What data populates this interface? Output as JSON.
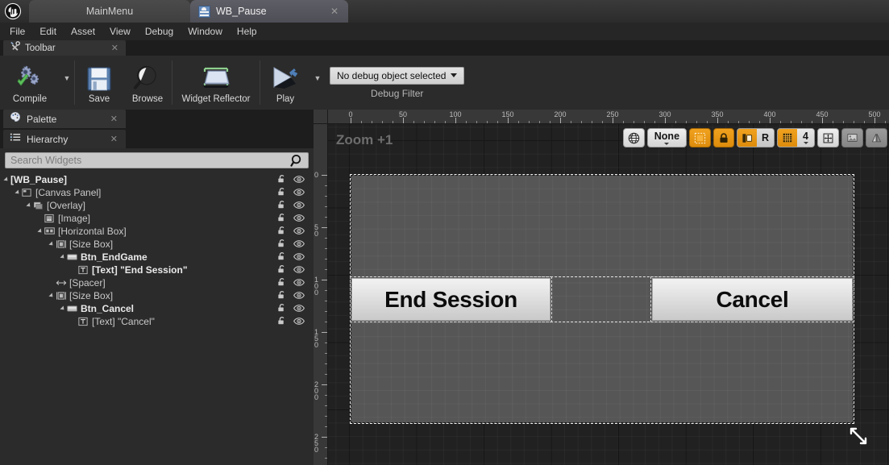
{
  "app": {
    "logo_icon": "unreal-engine-logo"
  },
  "tabs": [
    {
      "label": "MainMenu",
      "icon": "widget-blueprint-icon",
      "active": false,
      "close_label": "✕"
    },
    {
      "label": "WB_Pause",
      "icon": "widget-blueprint-icon",
      "active": true,
      "close_label": "✕"
    }
  ],
  "menubar": {
    "items": [
      "File",
      "Edit",
      "Asset",
      "View",
      "Debug",
      "Window",
      "Help"
    ]
  },
  "toolbar_panel": {
    "tab_label": "Toolbar",
    "tab_icon": "wrench-screwdriver-icon",
    "close_label": "✕",
    "buttons": [
      {
        "label": "Compile",
        "icon": "compile-gears-check-icon",
        "has_dropdown": true
      },
      {
        "label": "Save",
        "icon": "floppy-disk-icon",
        "has_dropdown": false
      },
      {
        "label": "Browse",
        "icon": "magnifier-icon",
        "has_dropdown": false
      },
      {
        "label": "Widget Reflector",
        "icon": "widget-reflector-icon",
        "has_dropdown": false
      },
      {
        "label": "Play",
        "icon": "play-triangle-icon",
        "has_dropdown": true
      }
    ],
    "debug_filter": {
      "value": "No debug object selected",
      "caption": "Debug Filter",
      "caret_icon": "chevron-down-icon"
    }
  },
  "left_panel": {
    "tabs": [
      {
        "label": "Palette",
        "icon": "palette-icon",
        "close_label": "✕",
        "active": false
      },
      {
        "label": "Hierarchy",
        "icon": "hierarchy-list-icon",
        "close_label": "✕",
        "active": true
      }
    ],
    "search": {
      "placeholder": "Search Widgets",
      "value": "",
      "icon": "search-icon"
    },
    "tree": [
      {
        "label": "[WB_Pause]",
        "indent": 0,
        "icon": "",
        "arrow": true,
        "bold": true,
        "lock": "unlocked-icon",
        "eye": "eye-icon"
      },
      {
        "label": "[Canvas Panel]",
        "indent": 1,
        "icon": "canvas",
        "arrow": true,
        "bold": false,
        "lock": "unlocked-icon",
        "eye": "eye-icon"
      },
      {
        "label": "[Overlay]",
        "indent": 2,
        "icon": "overlay",
        "arrow": true,
        "bold": false,
        "lock": "unlocked-icon",
        "eye": "eye-icon"
      },
      {
        "label": "[Image]",
        "indent": 3,
        "icon": "image",
        "arrow": false,
        "bold": false,
        "lock": "unlocked-icon",
        "eye": "eye-icon"
      },
      {
        "label": "[Horizontal Box]",
        "indent": 3,
        "icon": "hbox",
        "arrow": true,
        "bold": false,
        "lock": "unlocked-icon",
        "eye": "eye-icon"
      },
      {
        "label": "[Size Box]",
        "indent": 4,
        "icon": "sizebox",
        "arrow": true,
        "bold": false,
        "lock": "unlocked-icon",
        "eye": "eye-icon"
      },
      {
        "label": "Btn_EndGame",
        "indent": 5,
        "icon": "button",
        "arrow": true,
        "bold": true,
        "lock": "unlocked-icon",
        "eye": "eye-icon"
      },
      {
        "label": "[Text] \"End Session\"",
        "indent": 6,
        "icon": "text",
        "arrow": false,
        "bold": true,
        "lock": "unlocked-icon",
        "eye": "eye-icon"
      },
      {
        "label": "[Spacer]",
        "indent": 4,
        "icon": "spacer",
        "arrow": false,
        "bold": false,
        "lock": "unlocked-icon",
        "eye": "eye-icon"
      },
      {
        "label": "[Size Box]",
        "indent": 4,
        "icon": "sizebox",
        "arrow": true,
        "bold": false,
        "lock": "unlocked-icon",
        "eye": "eye-icon"
      },
      {
        "label": "Btn_Cancel",
        "indent": 5,
        "icon": "button",
        "arrow": true,
        "bold": true,
        "lock": "unlocked-icon",
        "eye": "eye-icon"
      },
      {
        "label": "[Text] \"Cancel\"",
        "indent": 6,
        "icon": "text",
        "arrow": false,
        "bold": false,
        "lock": "unlocked-icon",
        "eye": "eye-icon"
      }
    ]
  },
  "viewport": {
    "zoom_label": "Zoom +1",
    "ruler_h_ticks": [
      0,
      50,
      100,
      150,
      200,
      250,
      300,
      350,
      400,
      450,
      500
    ],
    "ruler_v_ticks": [
      0,
      50,
      100,
      150,
      200,
      250
    ],
    "toolbar": [
      {
        "name": "globe-icon",
        "type": "icon",
        "label": "",
        "style": "light"
      },
      {
        "name": "zoom-preset-dropdown",
        "type": "dropdown",
        "label": "None",
        "style": "light"
      },
      {
        "name": "dashed-outline-icon",
        "type": "icon",
        "label": "",
        "style": "orange"
      },
      {
        "name": "lock-icon",
        "type": "icon",
        "label": "",
        "style": "orange"
      },
      {
        "name": "localization-preview-toggle",
        "type": "split",
        "label": "R",
        "style": "orange-gray"
      },
      {
        "name": "grid-snapping-toggle",
        "type": "split-num",
        "label": "4",
        "style": "orange-num"
      },
      {
        "name": "fill-screen-icon",
        "type": "icon",
        "label": "",
        "style": "light"
      },
      {
        "name": "image-icon",
        "type": "icon",
        "label": "",
        "style": "gray"
      },
      {
        "name": "mirror-icon",
        "type": "icon",
        "label": "",
        "style": "gray"
      }
    ],
    "widgets": {
      "canvas_panel_name": "[Canvas Panel]",
      "button_end_session": "End Session",
      "button_cancel": "Cancel"
    },
    "resize_handle_icon": "resize-diagonal-icon"
  },
  "colors": {
    "accent_orange": "#dd8c0c",
    "panel_bg": "#2b2b2b",
    "window_bg": "#1d1d1d",
    "canvas_fill": "#565656",
    "button_face": "#e2e2e2"
  }
}
